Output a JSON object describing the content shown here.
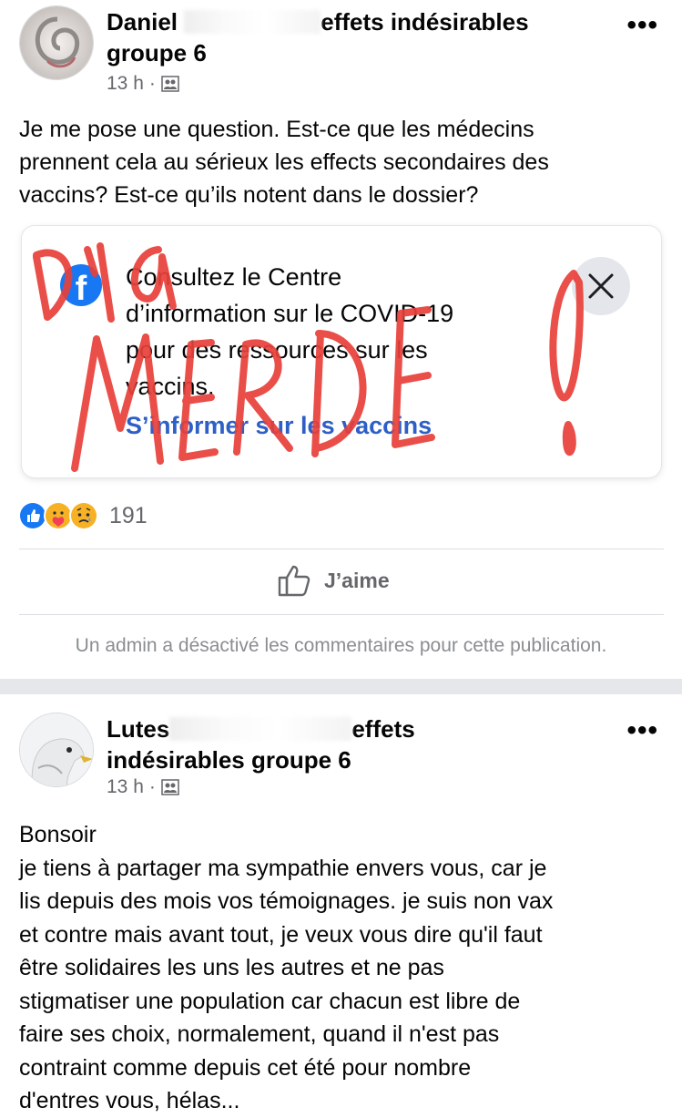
{
  "posts": [
    {
      "author_visible_start": "Daniel ",
      "group_visible_end": "effets indésirables",
      "group_line2": "groupe 6",
      "time": "13 h",
      "meta_sep": "·",
      "body": "Je me pose une question. Est-ce que les médecins\nprennent cela au sérieux les effects secondaires des\nvaccins? Est-ce qu’ils notent dans le dossier?",
      "info_card": {
        "text": "Consultez le Centre\nd’information sur le COVID-19\npour des ressources sur les\nvaccins.",
        "link": "S’informer sur les vaccins",
        "logo_letter": "f"
      },
      "scribble_text": "D’la MERDE !",
      "reaction_count": "191",
      "like_label": "J’aime",
      "admin_note": "Un admin a désactivé les commentaires pour cette publication."
    },
    {
      "author_visible_start": "Lutes",
      "group_visible_end": "effets",
      "group_line2": "indésirables groupe 6",
      "time": "13 h",
      "meta_sep": "·",
      "body": "Bonsoir\nje tiens à partager ma sympathie envers vous, car je\nlis depuis des mois vos témoignages. je suis non vax\net contre mais avant tout, je veux vous dire qu'il faut\nêtre solidaires les uns les autres et ne pas\nstigmatiser une population car chacun est libre de\nfaire ses choix, normalement, quand il n'est pas\ncontraint comme depuis cet été pour nombre\nd'entres vous, hélas..."
    }
  ],
  "more_label": "•••",
  "colors": {
    "link_blue": "#2d5fc6",
    "fb_blue": "#1877f2",
    "scribble_red": "#e8403a",
    "meta_gray": "#65676b"
  },
  "icons": {
    "privacy": "group-members-icon",
    "like": "thumbs-up-outline-icon",
    "reactions": [
      "like-reaction-icon",
      "care-reaction-icon",
      "sad-reaction-icon"
    ],
    "close": "close-icon"
  }
}
